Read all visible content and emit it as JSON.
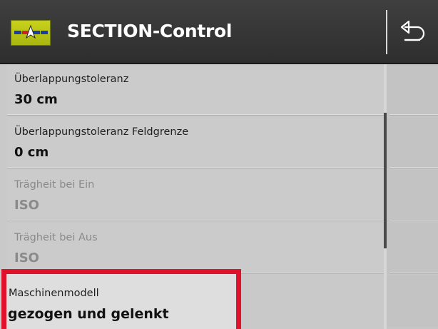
{
  "header": {
    "title": "SECTION-Control",
    "app_icon": "section-control-icon",
    "back_icon": "back-return-icon"
  },
  "items": [
    {
      "label": "Überlappungstoleranz",
      "value": "30 cm",
      "enabled": true
    },
    {
      "label": "Überlappungstoleranz Feldgrenze",
      "value": "0 cm",
      "enabled": true
    },
    {
      "label": "Trägheit bei Ein",
      "value": "ISO",
      "enabled": false
    },
    {
      "label": "Trägheit bei Aus",
      "value": "ISO",
      "enabled": false
    },
    {
      "label": "Maschinenmodell",
      "value": "gezogen und gelenkt",
      "enabled": true,
      "highlighted": true
    }
  ],
  "colors": {
    "header_bg": "#3a3a3a",
    "list_bg": "#cbcbcb",
    "disabled_text": "#8a8a8a",
    "highlight": "#e0112b",
    "app_icon_bg": "#b8c418"
  }
}
